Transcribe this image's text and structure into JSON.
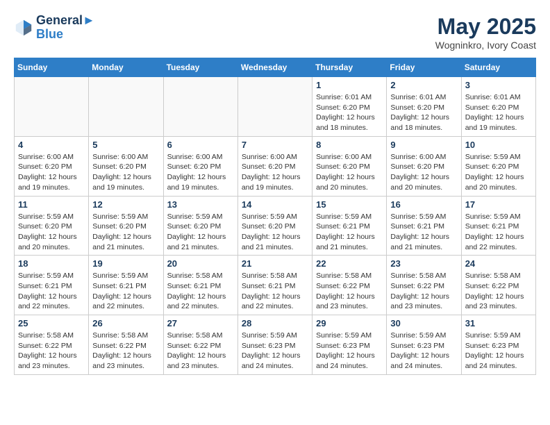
{
  "header": {
    "logo_line1": "General",
    "logo_line2": "Blue",
    "month_year": "May 2025",
    "location": "Wogninkro, Ivory Coast"
  },
  "days_of_week": [
    "Sunday",
    "Monday",
    "Tuesday",
    "Wednesday",
    "Thursday",
    "Friday",
    "Saturday"
  ],
  "weeks": [
    [
      {
        "day": "",
        "info": ""
      },
      {
        "day": "",
        "info": ""
      },
      {
        "day": "",
        "info": ""
      },
      {
        "day": "",
        "info": ""
      },
      {
        "day": "1",
        "info": "Sunrise: 6:01 AM\nSunset: 6:20 PM\nDaylight: 12 hours\nand 18 minutes."
      },
      {
        "day": "2",
        "info": "Sunrise: 6:01 AM\nSunset: 6:20 PM\nDaylight: 12 hours\nand 18 minutes."
      },
      {
        "day": "3",
        "info": "Sunrise: 6:01 AM\nSunset: 6:20 PM\nDaylight: 12 hours\nand 19 minutes."
      }
    ],
    [
      {
        "day": "4",
        "info": "Sunrise: 6:00 AM\nSunset: 6:20 PM\nDaylight: 12 hours\nand 19 minutes."
      },
      {
        "day": "5",
        "info": "Sunrise: 6:00 AM\nSunset: 6:20 PM\nDaylight: 12 hours\nand 19 minutes."
      },
      {
        "day": "6",
        "info": "Sunrise: 6:00 AM\nSunset: 6:20 PM\nDaylight: 12 hours\nand 19 minutes."
      },
      {
        "day": "7",
        "info": "Sunrise: 6:00 AM\nSunset: 6:20 PM\nDaylight: 12 hours\nand 19 minutes."
      },
      {
        "day": "8",
        "info": "Sunrise: 6:00 AM\nSunset: 6:20 PM\nDaylight: 12 hours\nand 20 minutes."
      },
      {
        "day": "9",
        "info": "Sunrise: 6:00 AM\nSunset: 6:20 PM\nDaylight: 12 hours\nand 20 minutes."
      },
      {
        "day": "10",
        "info": "Sunrise: 5:59 AM\nSunset: 6:20 PM\nDaylight: 12 hours\nand 20 minutes."
      }
    ],
    [
      {
        "day": "11",
        "info": "Sunrise: 5:59 AM\nSunset: 6:20 PM\nDaylight: 12 hours\nand 20 minutes."
      },
      {
        "day": "12",
        "info": "Sunrise: 5:59 AM\nSunset: 6:20 PM\nDaylight: 12 hours\nand 21 minutes."
      },
      {
        "day": "13",
        "info": "Sunrise: 5:59 AM\nSunset: 6:20 PM\nDaylight: 12 hours\nand 21 minutes."
      },
      {
        "day": "14",
        "info": "Sunrise: 5:59 AM\nSunset: 6:20 PM\nDaylight: 12 hours\nand 21 minutes."
      },
      {
        "day": "15",
        "info": "Sunrise: 5:59 AM\nSunset: 6:21 PM\nDaylight: 12 hours\nand 21 minutes."
      },
      {
        "day": "16",
        "info": "Sunrise: 5:59 AM\nSunset: 6:21 PM\nDaylight: 12 hours\nand 21 minutes."
      },
      {
        "day": "17",
        "info": "Sunrise: 5:59 AM\nSunset: 6:21 PM\nDaylight: 12 hours\nand 22 minutes."
      }
    ],
    [
      {
        "day": "18",
        "info": "Sunrise: 5:59 AM\nSunset: 6:21 PM\nDaylight: 12 hours\nand 22 minutes."
      },
      {
        "day": "19",
        "info": "Sunrise: 5:59 AM\nSunset: 6:21 PM\nDaylight: 12 hours\nand 22 minutes."
      },
      {
        "day": "20",
        "info": "Sunrise: 5:58 AM\nSunset: 6:21 PM\nDaylight: 12 hours\nand 22 minutes."
      },
      {
        "day": "21",
        "info": "Sunrise: 5:58 AM\nSunset: 6:21 PM\nDaylight: 12 hours\nand 22 minutes."
      },
      {
        "day": "22",
        "info": "Sunrise: 5:58 AM\nSunset: 6:22 PM\nDaylight: 12 hours\nand 23 minutes."
      },
      {
        "day": "23",
        "info": "Sunrise: 5:58 AM\nSunset: 6:22 PM\nDaylight: 12 hours\nand 23 minutes."
      },
      {
        "day": "24",
        "info": "Sunrise: 5:58 AM\nSunset: 6:22 PM\nDaylight: 12 hours\nand 23 minutes."
      }
    ],
    [
      {
        "day": "25",
        "info": "Sunrise: 5:58 AM\nSunset: 6:22 PM\nDaylight: 12 hours\nand 23 minutes."
      },
      {
        "day": "26",
        "info": "Sunrise: 5:58 AM\nSunset: 6:22 PM\nDaylight: 12 hours\nand 23 minutes."
      },
      {
        "day": "27",
        "info": "Sunrise: 5:58 AM\nSunset: 6:22 PM\nDaylight: 12 hours\nand 23 minutes."
      },
      {
        "day": "28",
        "info": "Sunrise: 5:59 AM\nSunset: 6:23 PM\nDaylight: 12 hours\nand 24 minutes."
      },
      {
        "day": "29",
        "info": "Sunrise: 5:59 AM\nSunset: 6:23 PM\nDaylight: 12 hours\nand 24 minutes."
      },
      {
        "day": "30",
        "info": "Sunrise: 5:59 AM\nSunset: 6:23 PM\nDaylight: 12 hours\nand 24 minutes."
      },
      {
        "day": "31",
        "info": "Sunrise: 5:59 AM\nSunset: 6:23 PM\nDaylight: 12 hours\nand 24 minutes."
      }
    ]
  ]
}
